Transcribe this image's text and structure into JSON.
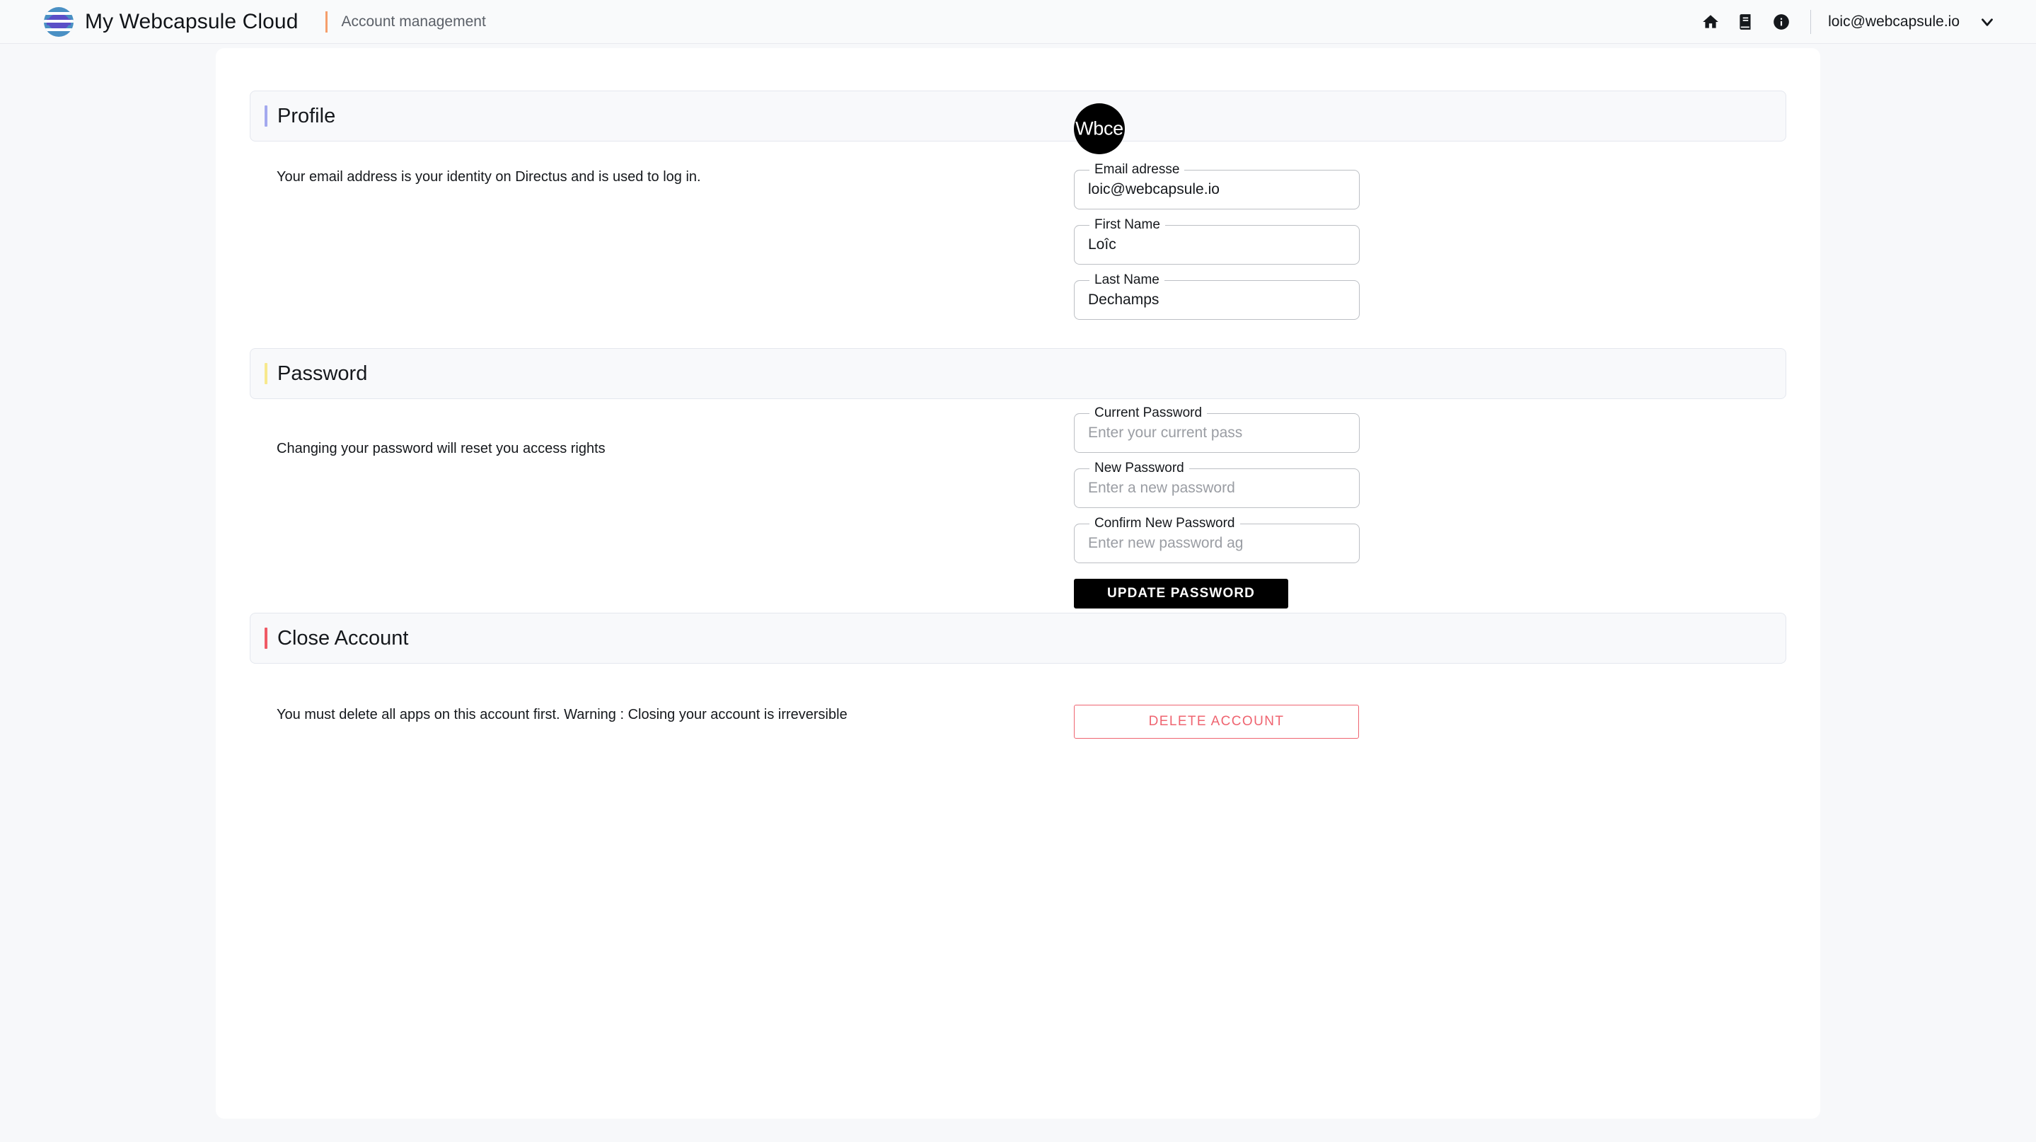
{
  "topbar": {
    "logo_icon": "webcapsule-sphere-logo",
    "brand_title": "My Webcapsule Cloud",
    "subtitle": "Account management",
    "icons": [
      {
        "name": "home-icon",
        "label": "Home"
      },
      {
        "name": "book-icon",
        "label": "Documentation"
      },
      {
        "name": "info-circle-icon",
        "label": "Information"
      }
    ],
    "user_email": "loic@webcapsule.io",
    "chevron_icon": "chevron-down-icon",
    "accent_color": "#f59e6b"
  },
  "profile": {
    "title": "Profile",
    "accent_color": "#a3a9ef",
    "description": "Your email address is your identity on Directus and is used to log in.",
    "avatar_initials": "Wbce",
    "fields": [
      {
        "label": "Email adresse",
        "value": "loic@webcapsule.io",
        "placeholder": ""
      },
      {
        "label": "First Name",
        "value": "Loîc",
        "placeholder": ""
      },
      {
        "label": "Last Name",
        "value": "Dechamps",
        "placeholder": ""
      }
    ]
  },
  "password": {
    "title": "Password",
    "accent_color": "#f7e98e",
    "description": "Changing your password will reset you access rights",
    "fields": [
      {
        "label": "Current Password",
        "value": "",
        "placeholder": "Enter your current pass"
      },
      {
        "label": "New Password",
        "value": "",
        "placeholder": "Enter a new password"
      },
      {
        "label": "Confirm New Password",
        "value": "",
        "placeholder": "Enter new password ag"
      }
    ],
    "submit_label": "UPDATE PASSWORD"
  },
  "close_account": {
    "title": "Close Account",
    "accent_color": "#ef5a66",
    "description": "You must delete all apps on this account first. Warning : Closing your account is irreversible",
    "delete_label": "DELETE ACCOUNT",
    "danger_color": "#ef6470"
  }
}
